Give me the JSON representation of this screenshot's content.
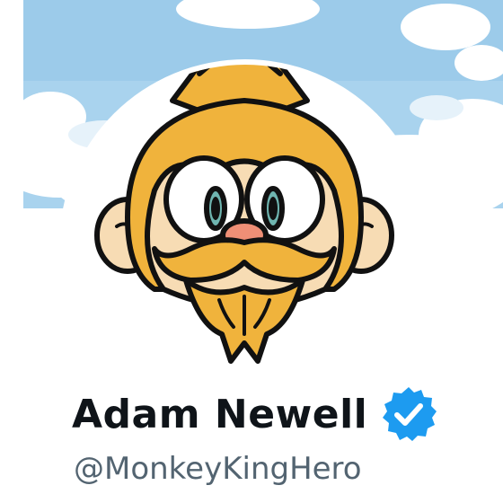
{
  "profile": {
    "display_name": "Adam Newell",
    "handle": "@MonkeyKingHero",
    "verified": true
  },
  "icons": {
    "verified": "verified-badge-icon",
    "avatar": "monkey-king-avatar"
  },
  "colors": {
    "banner_sky": "#a9d3ee",
    "cloud": "#ffffff",
    "verified_blue": "#1d9bf0",
    "name_text": "#0f1419",
    "handle_text": "#536471",
    "monkey_fur": "#f0b33c",
    "monkey_face": "#f7dcb4",
    "nose": "#ef8f76"
  }
}
